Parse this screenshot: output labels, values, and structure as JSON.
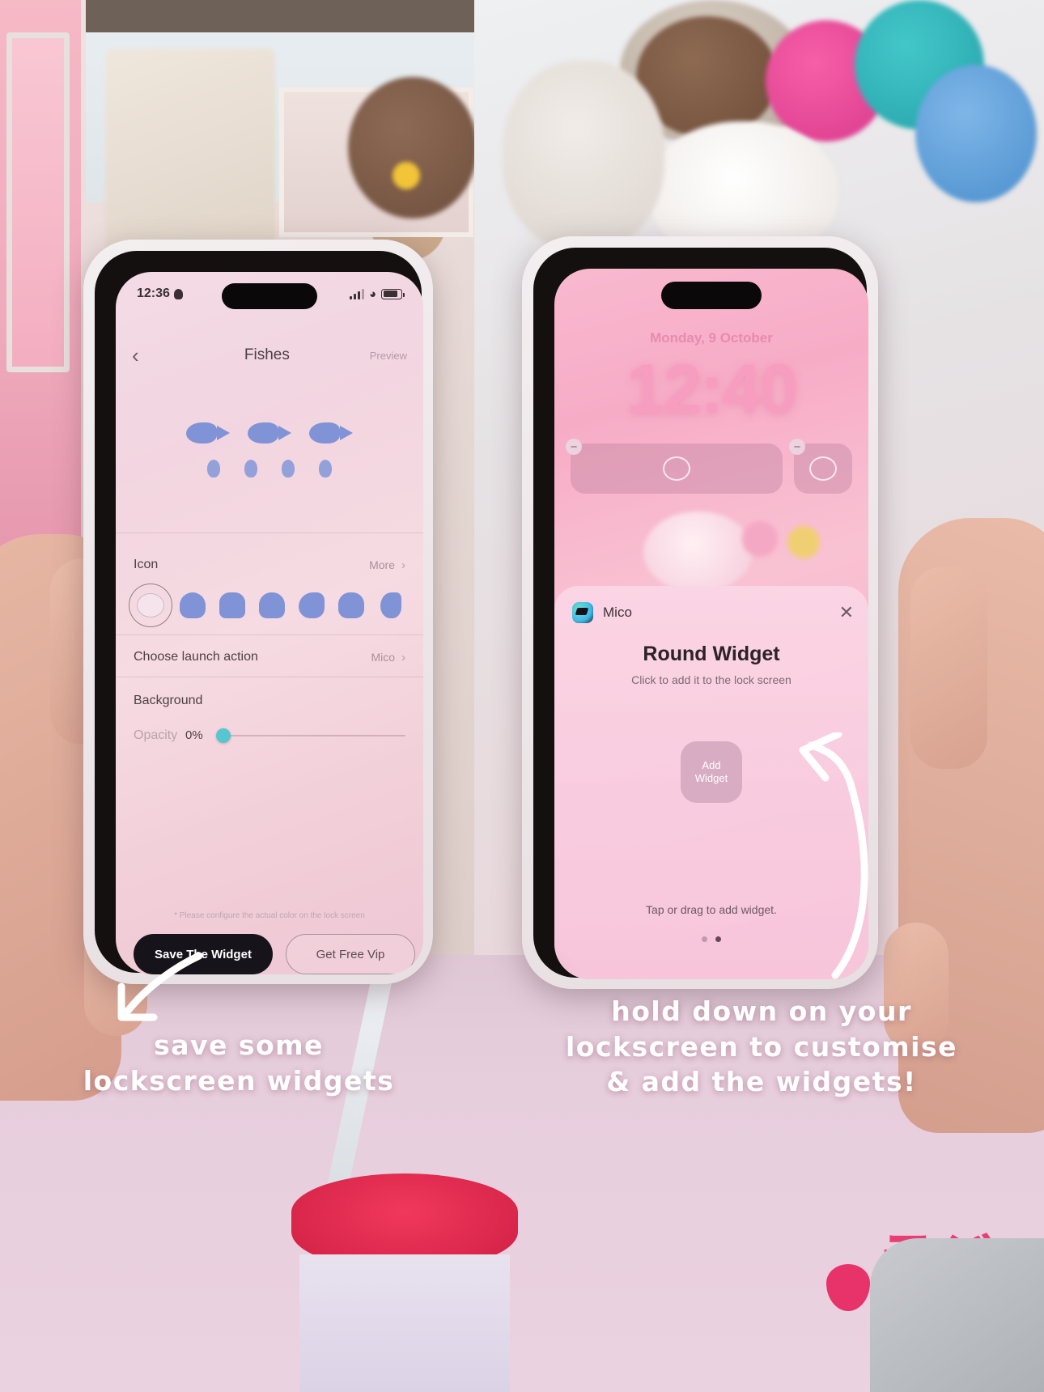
{
  "left_phone": {
    "status_bar": {
      "time": "12:36",
      "person_icon": "person-icon",
      "signal_icon": "signal-bars-icon",
      "wifi_icon": "wifi-icon",
      "battery_icon": "battery-icon"
    },
    "nav": {
      "back_icon": "chevron-left-icon",
      "title": "Fishes",
      "preview_label": "Preview"
    },
    "rows": {
      "icon_label": "Icon",
      "icon_more": "More",
      "launch_label": "Choose launch action",
      "launch_value": "Mico",
      "background_label": "Background",
      "opacity_label": "Opacity",
      "opacity_value": "0%"
    },
    "icons": [
      {
        "name": "bear-face-icon",
        "selected": true
      },
      {
        "name": "ghost-icon",
        "selected": false
      },
      {
        "name": "dog-icon",
        "selected": false
      },
      {
        "name": "cat-icon",
        "selected": false
      },
      {
        "name": "dinosaur-icon",
        "selected": false
      },
      {
        "name": "elephant-icon",
        "selected": false
      },
      {
        "name": "whale-icon",
        "selected": false
      }
    ],
    "disclaimer": "* Please configure the actual color on the lock screen",
    "buttons": {
      "save": "Save The Widget",
      "vip": "Get Free Vip"
    }
  },
  "right_phone": {
    "status_bar": {
      "time": "",
      "notch": "dynamic-island"
    },
    "lock": {
      "date": "Monday, 9 October",
      "time": "12:40"
    },
    "widgets": [
      {
        "name": "widget-wide-bear",
        "remove_badge": "−"
      },
      {
        "name": "widget-small-bear",
        "remove_badge": "−"
      }
    ],
    "sheet": {
      "app_name": "Mico",
      "close_icon": "close-icon",
      "title": "Round Widget",
      "subtitle": "Click to add it to the lock screen",
      "add_button": "Add\nWidget",
      "add_button_line1": "Add",
      "add_button_line2": "Widget",
      "hint": "Tap or drag to add widget.",
      "page_dots": 2,
      "active_dot": 2
    }
  },
  "captions": {
    "left_line1": "save some",
    "left_line2": "lockscreen widgets",
    "right_line1": "hold down on your",
    "right_line2": "lockscreen to customise",
    "right_line3": "& add the widgets!"
  },
  "colors": {
    "accent_teal": "#56c6d0",
    "lock_pink": "#f79ec0",
    "icon_blue": "#7f93d6",
    "button_dark": "#17131a",
    "caption_white": "#ffffff"
  }
}
